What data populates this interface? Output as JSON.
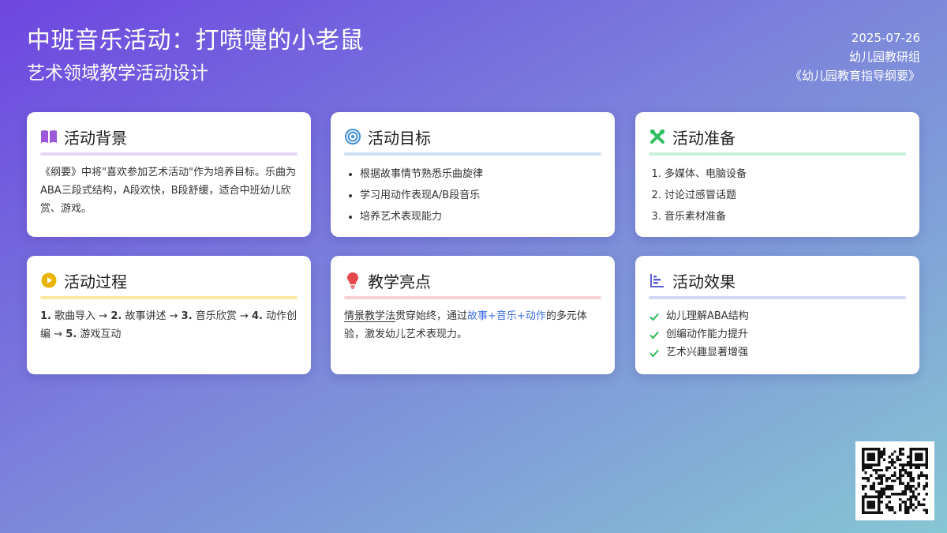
{
  "header": {
    "title": "中班音乐活动：打喷嚏的小老鼠",
    "subtitle": "艺术领域教学活动设计",
    "date": "2025-07-26",
    "org": "幼儿园教研组",
    "reference": "《幼儿园教育指导纲要》"
  },
  "cards": {
    "background": {
      "title": "活动背景",
      "icon": "book-icon",
      "accent": "#9b59d9",
      "text": "《纲要》中将\"喜欢参加艺术活动\"作为培养目标。乐曲为ABA三段式结构，A段欢快，B段舒缓，适合中班幼儿欣赏、游戏。"
    },
    "goals": {
      "title": "活动目标",
      "icon": "target-icon",
      "accent": "#3f8fd9",
      "items": [
        "根据故事情节熟悉乐曲旋律",
        "学习用动作表现A/B段音乐",
        "培养艺术表现能力"
      ]
    },
    "prep": {
      "title": "活动准备",
      "icon": "tools-icon",
      "accent": "#2fbf5f",
      "items": [
        "多媒体、电脑设备",
        "讨论过感冒话题",
        "音乐素材准备"
      ]
    },
    "process": {
      "title": "活动过程",
      "icon": "play-icon",
      "accent": "#e8b400",
      "steps": [
        {
          "no": "1.",
          "label": "歌曲导入"
        },
        {
          "no": "2.",
          "label": "故事讲述"
        },
        {
          "no": "3.",
          "label": "音乐欣赏"
        },
        {
          "no": "4.",
          "label": "动作创编"
        },
        {
          "no": "5.",
          "label": "游戏互动"
        }
      ],
      "arrow": "→"
    },
    "highlight": {
      "title": "教学亮点",
      "icon": "lightbulb-icon",
      "accent": "#e5484d",
      "method": "情景教学法",
      "part1": "贯穿始终，通过",
      "emph": "故事+音乐+动作",
      "part2": "的多元体验，激发幼儿艺术表现力。"
    },
    "effect": {
      "title": "活动效果",
      "icon": "bar-chart-icon",
      "accent": "#5b5fd6",
      "items": [
        "幼儿理解ABA结构",
        "创编动作能力提升",
        "艺术兴趣显著增强"
      ]
    }
  },
  "colors": {
    "check": "#2fb55a",
    "highlight_blue": "#3f6fe0"
  },
  "qr_code": {
    "icon": "qr-code-icon"
  }
}
